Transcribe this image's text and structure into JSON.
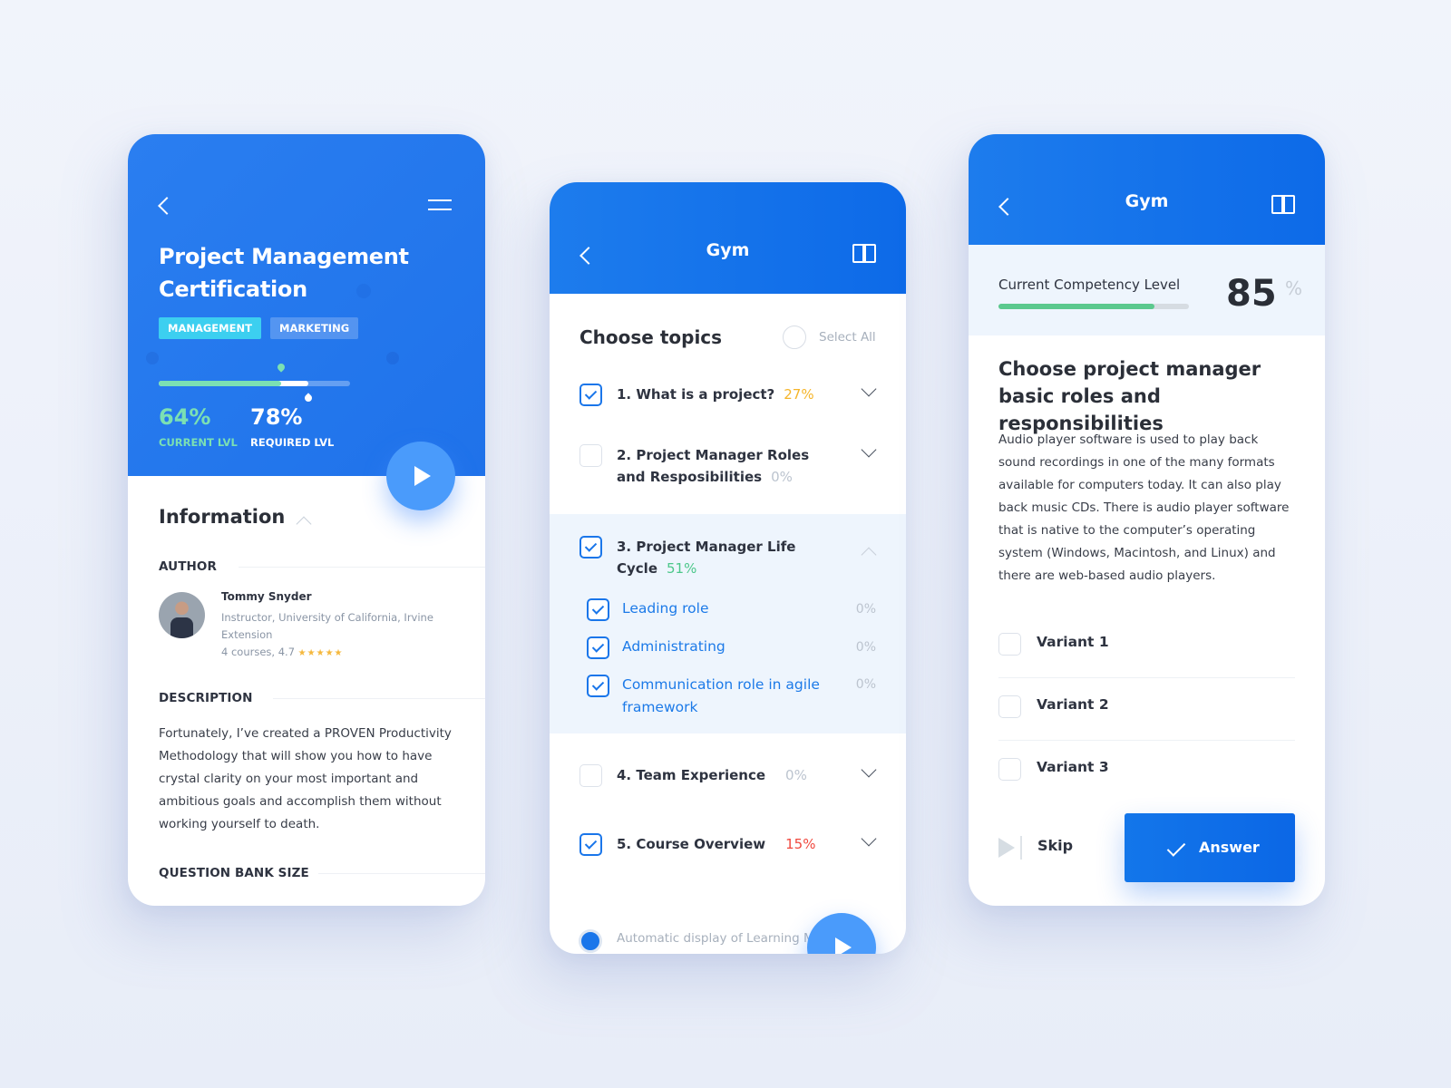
{
  "card1": {
    "title": "Project Management Certification",
    "tags": [
      "MANAGEMENT",
      "MARKETING"
    ],
    "current_level": {
      "value": "64%",
      "label": "CURRENT LVL",
      "fraction": 0.64
    },
    "required_level": {
      "value": "78%",
      "label": "REQUIRED LVL",
      "fraction": 0.78
    },
    "info_title": "Information",
    "author_heading": "AUTHOR",
    "author": {
      "name": "Tommy Snyder",
      "role": "Instructor, University of California, Irvine Extension",
      "stats": "4 courses,  4.7",
      "stars": "★★★★★",
      "rating": 4.7
    },
    "description_heading": "DESCRIPTION",
    "description": "Fortunately, I’ve created a PROVEN Productivity Methodology that will show you how to have crystal clarity on your most important and ambitious goals and accomplish them without working yourself to death.",
    "question_bank_heading": "QUESTION BANK SIZE",
    "colors": {
      "accent": "#1f72ea",
      "current": "#7be0b3",
      "fab": "#4a9bfb"
    }
  },
  "card2": {
    "nav_title": "Gym",
    "heading": "Choose topics",
    "select_all": "Select All",
    "topics": [
      {
        "label": "1. What is a project?",
        "pct": "27%",
        "pct_color": "#f5b52a",
        "checked": true
      },
      {
        "label": "2. Project Manager Roles and Resposibilities",
        "pct": "0%",
        "pct_color": "#bcc4cf",
        "checked": false
      },
      {
        "label": "3. Project Manager Life Cycle",
        "pct": "51%",
        "pct_color": "#4cc78a",
        "checked": true
      },
      {
        "label": "4. Team Experience",
        "pct": "0%",
        "pct_color": "#bcc4cf",
        "checked": false
      },
      {
        "label": "5. Course Overview",
        "pct": "15%",
        "pct_color": "#f0483e",
        "checked": true
      }
    ],
    "subtopics": [
      {
        "label": "Leading role",
        "pct": "0%",
        "checked": true
      },
      {
        "label": "Administrating",
        "pct": "0%",
        "checked": true
      },
      {
        "label": "Communication role in agile framework",
        "pct": "0%",
        "checked": true
      }
    ],
    "auto_display": "Automatic display of Learning Materials"
  },
  "card3": {
    "nav_title": "Gym",
    "competency_label": "Current Competency Level",
    "competency_value": "85",
    "competency_unit": "%",
    "competency_fraction": 0.82,
    "question_title": "Choose project manager basic roles and responsibilities",
    "question_body": "Audio player software is used to play back sound recordings in one of the many formats available for computers today. It can also play back music CDs. There is audio player software that is native to the computer’s operating system (Windows, Macintosh, and Linux) and there are web-based audio players.",
    "variants": [
      "Variant 1",
      "Variant 2",
      "Variant 3"
    ],
    "skip_label": "Skip",
    "answer_label": "Answer"
  }
}
